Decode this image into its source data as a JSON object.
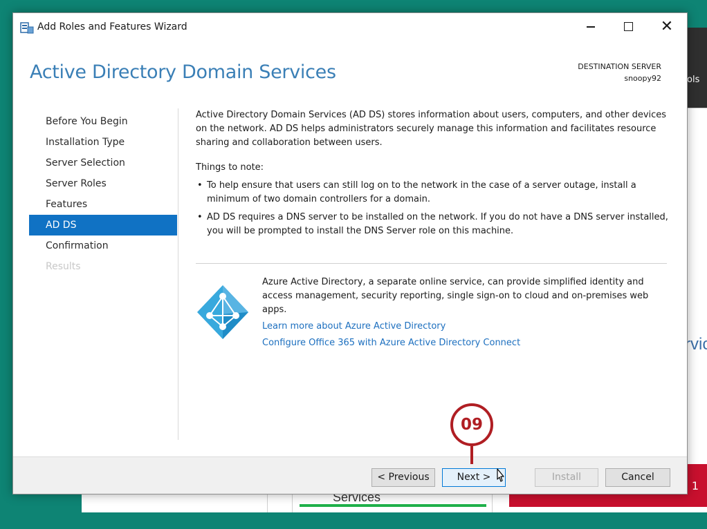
{
  "background": {
    "tools_label": "ols",
    "services_partial": "rvic",
    "tile_label": "Services",
    "alert_count": "1"
  },
  "window": {
    "title": "Add Roles and Features Wizard",
    "minimize_label": "Minimize",
    "maximize_label": "Maximize",
    "close_glyph": "✕"
  },
  "header": {
    "page_title": "Active Directory Domain Services",
    "destination_label": "DESTINATION SERVER",
    "destination_server": "snoopy92"
  },
  "nav": {
    "items": [
      {
        "label": "Before You Begin",
        "state": "normal"
      },
      {
        "label": "Installation Type",
        "state": "normal"
      },
      {
        "label": "Server Selection",
        "state": "normal"
      },
      {
        "label": "Server Roles",
        "state": "normal"
      },
      {
        "label": "Features",
        "state": "normal"
      },
      {
        "label": "AD DS",
        "state": "active"
      },
      {
        "label": "Confirmation",
        "state": "normal"
      },
      {
        "label": "Results",
        "state": "disabled"
      }
    ]
  },
  "content": {
    "intro": "Active Directory Domain Services (AD DS) stores information about users, computers, and other devices on the network.  AD DS helps administrators securely manage this information and facilitates resource sharing and collaboration between users.",
    "notes_title": "Things to note:",
    "notes": [
      "To help ensure that users can still log on to the network in the case of a server outage, install a minimum of two domain controllers for a domain.",
      "AD DS requires a DNS server to be installed on the network.  If you do not have a DNS server installed, you will be prompted to install the DNS Server role on this machine."
    ],
    "azure": {
      "description": "Azure Active Directory, a separate online service, can provide simplified identity and access management, security reporting, single sign-on to cloud and on-premises web apps.",
      "link_learn": "Learn more about Azure Active Directory",
      "link_configure": "Configure Office 365 with Azure Active Directory Connect"
    }
  },
  "footer": {
    "previous": "< Previous",
    "next": "Next >",
    "install": "Install",
    "cancel": "Cancel"
  },
  "annotation": {
    "step": "09"
  },
  "colors": {
    "accent": "#1072c4",
    "title_blue": "#3a7fb6",
    "link_blue": "#1c6fbf",
    "callout_red": "#b01e23",
    "desktop_teal": "#0e8474"
  }
}
